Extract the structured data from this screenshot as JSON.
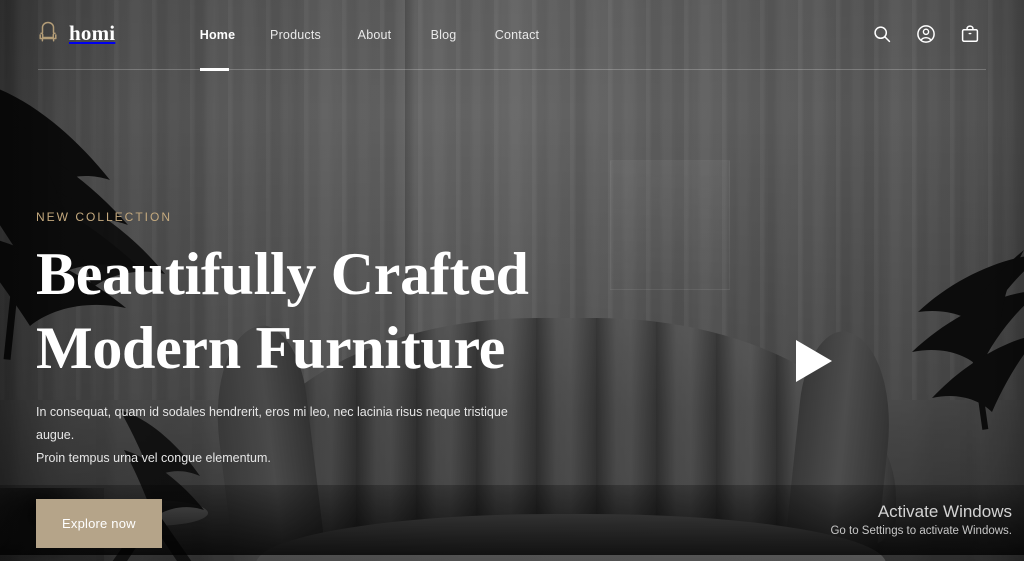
{
  "site": {
    "brand_name": "homi",
    "brand_icon": "armchair-icon",
    "accent_color": "#b5a489",
    "eyebrow_color": "#c4a97e"
  },
  "header": {
    "nav_items": [
      {
        "label": "Home",
        "active": true
      },
      {
        "label": "Products",
        "active": false
      },
      {
        "label": "About",
        "active": false
      },
      {
        "label": "Blog",
        "active": false
      },
      {
        "label": "Contact",
        "active": false
      }
    ],
    "actions": [
      {
        "name": "search-icon",
        "title": "Search"
      },
      {
        "name": "account-icon",
        "title": "Account"
      },
      {
        "name": "cart-icon",
        "title": "Cart"
      }
    ]
  },
  "hero": {
    "eyebrow": "NEW COLLECTION",
    "title_line1": "Beautifully Crafted",
    "title_line2": "Modern Furniture",
    "subtitle_line1": "In consequat, quam id sodales hendrerit, eros mi leo, nec lacinia risus neque tristique augue.",
    "subtitle_line2": "Proin tempus urna vel congue elementum.",
    "cta_label": "Explore now",
    "play_button": "play-video-button"
  },
  "watermark": {
    "title": "Activate Windows",
    "subtitle": "Go to Settings to activate Windows."
  }
}
